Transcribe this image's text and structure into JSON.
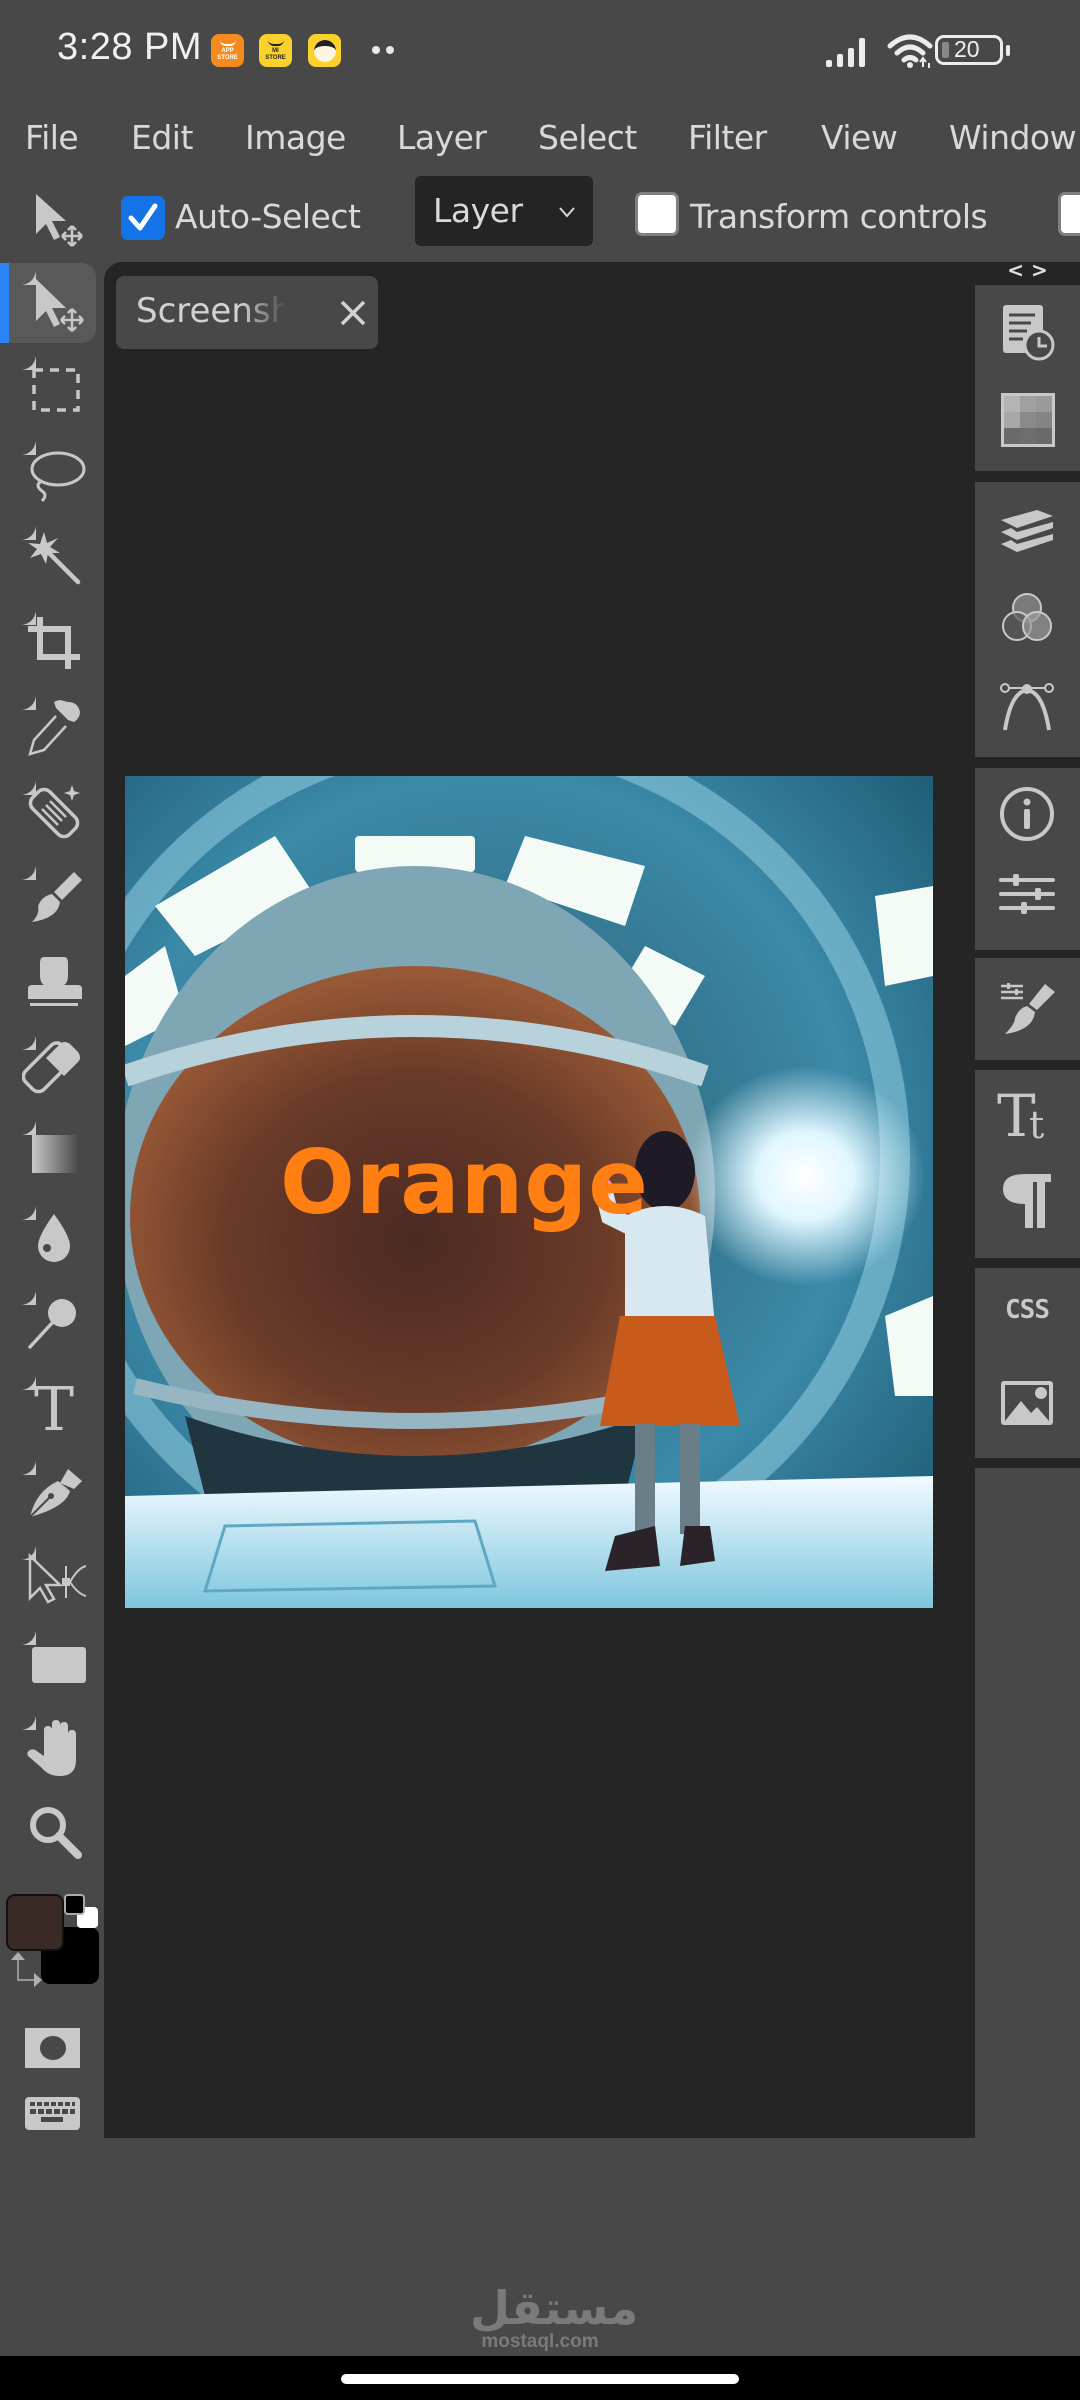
{
  "status_bar": {
    "time": "3:28 PM",
    "notification_apps": [
      {
        "name": "app-store",
        "label_line1": "APP",
        "label_line2": "STORE"
      },
      {
        "name": "mi-store",
        "label_line1": "MI",
        "label_line2": "STORE"
      },
      {
        "name": "character-app"
      }
    ],
    "more_indicator": "••",
    "battery_percent": "20",
    "icons": [
      "signal-icon",
      "wifi-icon",
      "battery-icon"
    ]
  },
  "menu": {
    "items": [
      "File",
      "Edit",
      "Image",
      "Layer",
      "Select",
      "Filter",
      "View",
      "Window"
    ]
  },
  "options_bar": {
    "tool_icon": "move-tool-icon",
    "auto_select": {
      "label": "Auto-Select",
      "checked": true
    },
    "target_select": {
      "value": "Layer"
    },
    "transform_controls": {
      "label": "Transform controls",
      "checked": false
    },
    "extra_checkbox": {
      "checked": false
    }
  },
  "tools": [
    {
      "name": "move-tool",
      "icon": "move-icon",
      "active": true
    },
    {
      "name": "rectangular-marquee-tool",
      "icon": "marquee-icon"
    },
    {
      "name": "lasso-tool",
      "icon": "lasso-icon"
    },
    {
      "name": "magic-wand-tool",
      "icon": "magic-wand-icon"
    },
    {
      "name": "crop-tool",
      "icon": "crop-icon"
    },
    {
      "name": "eyedropper-tool",
      "icon": "eyedropper-icon"
    },
    {
      "name": "healing-brush-tool",
      "icon": "bandage-icon"
    },
    {
      "name": "brush-tool",
      "icon": "brush-icon"
    },
    {
      "name": "clone-stamp-tool",
      "icon": "stamp-icon"
    },
    {
      "name": "eraser-tool",
      "icon": "eraser-icon"
    },
    {
      "name": "gradient-tool",
      "icon": "gradient-icon"
    },
    {
      "name": "blur-tool",
      "icon": "drop-icon"
    },
    {
      "name": "dodge-tool",
      "icon": "dodge-icon"
    },
    {
      "name": "type-tool",
      "icon": "type-icon"
    },
    {
      "name": "pen-tool",
      "icon": "pen-icon"
    },
    {
      "name": "path-select-tool",
      "icon": "path-select-icon"
    },
    {
      "name": "rectangle-shape-tool",
      "icon": "rectangle-icon"
    },
    {
      "name": "hand-tool",
      "icon": "hand-icon"
    },
    {
      "name": "zoom-tool",
      "icon": "zoom-icon"
    }
  ],
  "colors": {
    "foreground": "#3a2a26",
    "background": "#000000",
    "accent": "#1473e6",
    "active_tool_marker": "#2d84f8",
    "canvas_text": "#ff7f12"
  },
  "quick_mask_icon": "quick-mask-icon",
  "keyboard_icon": "keyboard-icon",
  "document": {
    "tab_name": "Screenshot",
    "close_icon": "close-icon",
    "canvas_text": "Orange"
  },
  "right_panel": {
    "collapse_label": "< >",
    "groups": [
      [
        "history-icon",
        "swatches-icon"
      ],
      [
        "layers-icon",
        "channels-icon",
        "paths-icon"
      ],
      [
        "info-icon",
        "properties-icon"
      ],
      [
        "brush-settings-icon"
      ],
      [
        "character-icon",
        "paragraph-icon"
      ],
      [
        "css-icon",
        "image-icon"
      ]
    ],
    "css_label": "CSS"
  },
  "watermark": {
    "arabic": "مستقل",
    "latin": "mostaql.com"
  }
}
